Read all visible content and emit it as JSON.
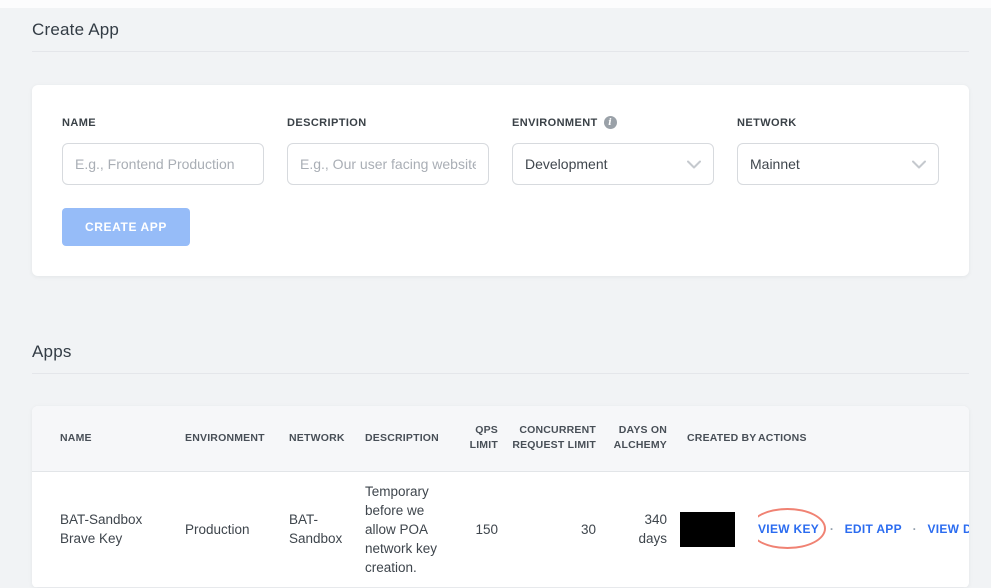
{
  "create_app": {
    "title": "Create App",
    "fields": {
      "name": {
        "label": "NAME",
        "placeholder": "E.g., Frontend Production"
      },
      "description": {
        "label": "DESCRIPTION",
        "placeholder": "E.g., Our user facing website"
      },
      "environment": {
        "label": "ENVIRONMENT",
        "value": "Development",
        "info_icon_glyph": "i"
      },
      "network": {
        "label": "NETWORK",
        "value": "Mainnet"
      }
    },
    "submit_label": "CREATE APP"
  },
  "apps": {
    "title": "Apps",
    "columns": [
      "NAME",
      "ENVIRONMENT",
      "NETWORK",
      "DESCRIPTION",
      "QPS LIMIT",
      "CONCURRENT REQUEST LIMIT",
      "DAYS ON ALCHEMY",
      "CREATED BY",
      "ACTIONS"
    ],
    "row": {
      "name": "BAT-Sandbox Brave Key",
      "environment": "Production",
      "network": "BAT-Sandbox",
      "description": "Temporary before we allow POA network key creation.",
      "qps_limit": "150",
      "concurrent_request_limit": "30",
      "days_on_alchemy": "340 days",
      "created_by_redacted": true,
      "actions": {
        "view_key": "VIEW KEY",
        "edit_app": "EDIT APP",
        "view_details": "VIEW DETAILS",
        "separator": "·"
      }
    }
  },
  "colors": {
    "page_bg": "#f1f3f5",
    "accent_link_blue": "#2b6cf0",
    "create_button_blue": "#96bcf8",
    "annotation_ellipse_red": "#f08273",
    "redacted_black": "#000000"
  }
}
